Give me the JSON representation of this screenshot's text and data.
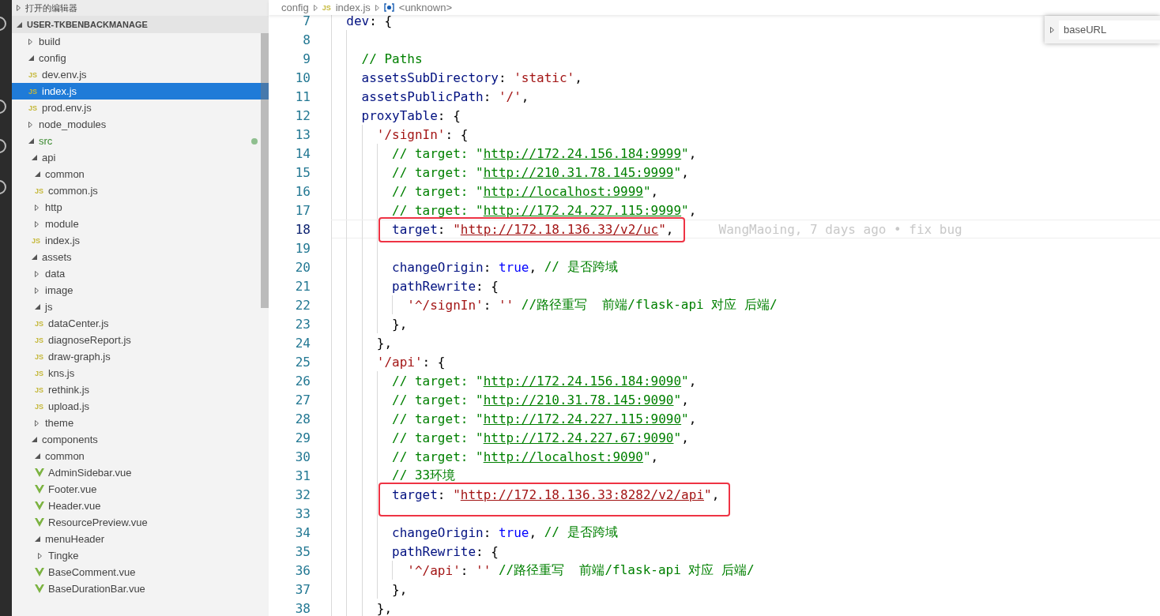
{
  "sidebar": {
    "sections": [
      {
        "title": "打开的编辑器",
        "expanded": false
      },
      {
        "title": "USER-TKBENBACKMANAGE",
        "expanded": true
      }
    ],
    "tree": [
      {
        "kind": "folder",
        "label": "build",
        "expanded": false
      },
      {
        "kind": "folder",
        "label": "config",
        "expanded": true,
        "children": [
          {
            "kind": "js",
            "icon_text": "JS",
            "label": "dev.env.js",
            "selected": false
          },
          {
            "kind": "js",
            "icon_text": "JS",
            "label": "index.js",
            "selected": true
          },
          {
            "kind": "js",
            "icon_text": "JS",
            "label": "prod.env.js",
            "selected": false
          }
        ]
      },
      {
        "kind": "folder",
        "label": "node_modules",
        "expanded": false
      },
      {
        "kind": "folder",
        "label": "src",
        "expanded": true,
        "modified": true,
        "children": [
          {
            "kind": "folder",
            "label": "api",
            "expanded": true,
            "children": [
              {
                "kind": "folder",
                "label": "common",
                "expanded": true,
                "children": [
                  {
                    "kind": "js",
                    "icon_text": "JS",
                    "label": "common.js",
                    "selected": false
                  }
                ]
              },
              {
                "kind": "folder",
                "label": "http",
                "expanded": false
              },
              {
                "kind": "folder",
                "label": "module",
                "expanded": false
              },
              {
                "kind": "js",
                "icon_text": "JS",
                "label": "index.js",
                "selected": false
              }
            ]
          },
          {
            "kind": "folder",
            "label": "assets",
            "expanded": true,
            "children": [
              {
                "kind": "folder",
                "label": "data",
                "expanded": false
              },
              {
                "kind": "folder",
                "label": "image",
                "expanded": false
              },
              {
                "kind": "folder",
                "label": "js",
                "expanded": true,
                "children": [
                  {
                    "kind": "js",
                    "icon_text": "JS",
                    "label": "dataCenter.js",
                    "selected": false
                  },
                  {
                    "kind": "js",
                    "icon_text": "JS",
                    "label": "diagnoseReport.js",
                    "selected": false
                  },
                  {
                    "kind": "js",
                    "icon_text": "JS",
                    "label": "draw-graph.js",
                    "selected": false
                  },
                  {
                    "kind": "js",
                    "icon_text": "JS",
                    "label": "kns.js",
                    "selected": false
                  },
                  {
                    "kind": "js",
                    "icon_text": "JS",
                    "label": "rethink.js",
                    "selected": false
                  },
                  {
                    "kind": "js",
                    "icon_text": "JS",
                    "label": "upload.js",
                    "selected": false
                  }
                ]
              },
              {
                "kind": "folder",
                "label": "theme",
                "expanded": false
              }
            ]
          },
          {
            "kind": "folder",
            "label": "components",
            "expanded": true,
            "children": [
              {
                "kind": "folder",
                "label": "common",
                "expanded": true,
                "children": [
                  {
                    "kind": "vue",
                    "label": "AdminSidebar.vue",
                    "selected": false
                  },
                  {
                    "kind": "vue",
                    "label": "Footer.vue",
                    "selected": false
                  },
                  {
                    "kind": "vue",
                    "label": "Header.vue",
                    "selected": false
                  },
                  {
                    "kind": "vue",
                    "label": "ResourcePreview.vue",
                    "selected": false
                  }
                ]
              },
              {
                "kind": "folder",
                "label": "menuHeader",
                "expanded": true,
                "children": [
                  {
                    "kind": "folder",
                    "label": "Tingke",
                    "expanded": false
                  },
                  {
                    "kind": "vue",
                    "label": "BaseComment.vue",
                    "selected": false
                  },
                  {
                    "kind": "vue",
                    "label": "BaseDurationBar.vue",
                    "selected": false
                  }
                ]
              }
            ]
          }
        ]
      }
    ]
  },
  "breadcrumb": [
    {
      "kind": "folder",
      "text": "config"
    },
    {
      "kind": "js",
      "icon_text": "JS",
      "text": "index.js"
    },
    {
      "kind": "symbol",
      "text": "<unknown>"
    }
  ],
  "find_widget": {
    "value": "baseURL",
    "expanded": false
  },
  "editor": {
    "lines": [
      {
        "number": "7",
        "tokens": [
          {
            "kind": "key",
            "text": "  dev"
          },
          {
            "kind": "punct",
            "text": ": {"
          }
        ]
      },
      {
        "number": "8"
      },
      {
        "number": "9",
        "tokens": [
          {
            "kind": "comment",
            "text": "    // Paths"
          }
        ]
      },
      {
        "number": "10",
        "tokens": [
          {
            "kind": "key",
            "text": "    assetsSubDirectory"
          },
          {
            "kind": "punct",
            "text": ": "
          },
          {
            "kind": "str",
            "text": "'static'"
          },
          {
            "kind": "punct",
            "text": ","
          }
        ]
      },
      {
        "number": "11",
        "tokens": [
          {
            "kind": "key",
            "text": "    assetsPublicPath"
          },
          {
            "kind": "punct",
            "text": ": "
          },
          {
            "kind": "str",
            "text": "'/'"
          },
          {
            "kind": "punct",
            "text": ","
          }
        ]
      },
      {
        "number": "12",
        "tokens": [
          {
            "kind": "key",
            "text": "    proxyTable"
          },
          {
            "kind": "punct",
            "text": ": {"
          }
        ]
      },
      {
        "number": "13",
        "tokens": [
          {
            "kind": "str",
            "text": "      '/signIn'"
          },
          {
            "kind": "punct",
            "text": ": {"
          }
        ]
      },
      {
        "number": "14",
        "tokens": [
          {
            "kind": "comment",
            "text": "        // target: \""
          },
          {
            "kind": "comment-link",
            "text": "http://172.24.156.184:9999"
          },
          {
            "kind": "comment",
            "text": "\""
          },
          {
            "kind": "punct",
            "text": ","
          }
        ]
      },
      {
        "number": "15",
        "tokens": [
          {
            "kind": "comment",
            "text": "        // target: \""
          },
          {
            "kind": "comment-link",
            "text": "http://210.31.78.145:9999"
          },
          {
            "kind": "comment",
            "text": "\""
          },
          {
            "kind": "punct",
            "text": ","
          }
        ]
      },
      {
        "number": "16",
        "tokens": [
          {
            "kind": "comment",
            "text": "        // target: \""
          },
          {
            "kind": "comment-link",
            "text": "http://localhost:9999"
          },
          {
            "kind": "comment",
            "text": "\""
          },
          {
            "kind": "punct",
            "text": ","
          }
        ]
      },
      {
        "number": "17",
        "tokens": [
          {
            "kind": "comment",
            "text": "        // target: \""
          },
          {
            "kind": "comment-link",
            "text": "http://172.24.227.115:9999"
          },
          {
            "kind": "comment",
            "text": "\""
          },
          {
            "kind": "punct",
            "text": ","
          }
        ]
      },
      {
        "number": "18",
        "current": true,
        "mark": {
          "kind": "red-box",
          "covers_next_line": false
        },
        "blame": "WangMaoing, 7 days ago • fix bug",
        "tokens": [
          {
            "kind": "key",
            "text": "        target"
          },
          {
            "kind": "punct",
            "text": ": "
          },
          {
            "kind": "str",
            "text": "\""
          },
          {
            "kind": "string-link",
            "text": "http://172.18.136.33/v2/uc"
          },
          {
            "kind": "str",
            "text": "\""
          },
          {
            "kind": "punct",
            "text": ","
          }
        ]
      },
      {
        "number": "19"
      },
      {
        "number": "20",
        "tokens": [
          {
            "kind": "key",
            "text": "        changeOrigin"
          },
          {
            "kind": "punct",
            "text": ": "
          },
          {
            "kind": "kw",
            "text": "true"
          },
          {
            "kind": "punct",
            "text": ", "
          },
          {
            "kind": "comment",
            "text": "// 是否跨域"
          }
        ]
      },
      {
        "number": "21",
        "tokens": [
          {
            "kind": "key",
            "text": "        pathRewrite"
          },
          {
            "kind": "punct",
            "text": ": {"
          }
        ]
      },
      {
        "number": "22",
        "tokens": [
          {
            "kind": "str",
            "text": "          '^/signIn'"
          },
          {
            "kind": "punct",
            "text": ": "
          },
          {
            "kind": "str",
            "text": "''"
          },
          {
            "kind": "comment",
            "text": " //路径重写  前端/flask-api 对应 后端/"
          }
        ]
      },
      {
        "number": "23",
        "tokens": [
          {
            "kind": "punct",
            "text": "        },"
          }
        ]
      },
      {
        "number": "24",
        "tokens": [
          {
            "kind": "punct",
            "text": "      },"
          }
        ]
      },
      {
        "number": "25",
        "tokens": [
          {
            "kind": "str",
            "text": "      '/api'"
          },
          {
            "kind": "punct",
            "text": ": {"
          }
        ]
      },
      {
        "number": "26",
        "tokens": [
          {
            "kind": "comment",
            "text": "        // target: \""
          },
          {
            "kind": "comment-link",
            "text": "http://172.24.156.184:9090"
          },
          {
            "kind": "comment",
            "text": "\""
          },
          {
            "kind": "punct",
            "text": ","
          }
        ]
      },
      {
        "number": "27",
        "tokens": [
          {
            "kind": "comment",
            "text": "        // target: \""
          },
          {
            "kind": "comment-link",
            "text": "http://210.31.78.145:9090"
          },
          {
            "kind": "comment",
            "text": "\""
          },
          {
            "kind": "punct",
            "text": ","
          }
        ]
      },
      {
        "number": "28",
        "tokens": [
          {
            "kind": "comment",
            "text": "        // target: \""
          },
          {
            "kind": "comment-link",
            "text": "http://172.24.227.115:9090"
          },
          {
            "kind": "comment",
            "text": "\""
          },
          {
            "kind": "punct",
            "text": ","
          }
        ]
      },
      {
        "number": "29",
        "tokens": [
          {
            "kind": "comment",
            "text": "        // target: \""
          },
          {
            "kind": "comment-link",
            "text": "http://172.24.227.67:9090"
          },
          {
            "kind": "comment",
            "text": "\""
          },
          {
            "kind": "punct",
            "text": ","
          }
        ]
      },
      {
        "number": "30",
        "tokens": [
          {
            "kind": "comment",
            "text": "        // target: \""
          },
          {
            "kind": "comment-link",
            "text": "http://localhost:9090"
          },
          {
            "kind": "comment",
            "text": "\""
          },
          {
            "kind": "punct",
            "text": ","
          }
        ]
      },
      {
        "number": "31",
        "tokens": [
          {
            "kind": "comment",
            "text": "        // 33环境"
          }
        ]
      },
      {
        "number": "32",
        "mark": {
          "kind": "red-box",
          "covers_next_line": true
        },
        "tokens": [
          {
            "kind": "key",
            "text": "        target"
          },
          {
            "kind": "punct",
            "text": ": "
          },
          {
            "kind": "str",
            "text": "\""
          },
          {
            "kind": "string-link",
            "text": "http://172.18.136.33:8282/v2/api"
          },
          {
            "kind": "str",
            "text": "\""
          },
          {
            "kind": "punct",
            "text": ","
          }
        ]
      },
      {
        "number": "33"
      },
      {
        "number": "34",
        "tokens": [
          {
            "kind": "key",
            "text": "        changeOrigin"
          },
          {
            "kind": "punct",
            "text": ": "
          },
          {
            "kind": "kw",
            "text": "true"
          },
          {
            "kind": "punct",
            "text": ", "
          },
          {
            "kind": "comment",
            "text": "// 是否跨域"
          }
        ]
      },
      {
        "number": "35",
        "tokens": [
          {
            "kind": "key",
            "text": "        pathRewrite"
          },
          {
            "kind": "punct",
            "text": ": {"
          }
        ]
      },
      {
        "number": "36",
        "tokens": [
          {
            "kind": "str",
            "text": "          '^/api'"
          },
          {
            "kind": "punct",
            "text": ": "
          },
          {
            "kind": "str",
            "text": "''"
          },
          {
            "kind": "comment",
            "text": " //路径重写  前端/flask-api 对应 后端/"
          }
        ]
      },
      {
        "number": "37",
        "tokens": [
          {
            "kind": "punct",
            "text": "        },"
          }
        ]
      },
      {
        "number": "38",
        "tokens": [
          {
            "kind": "punct",
            "text": "      },"
          }
        ]
      }
    ]
  }
}
